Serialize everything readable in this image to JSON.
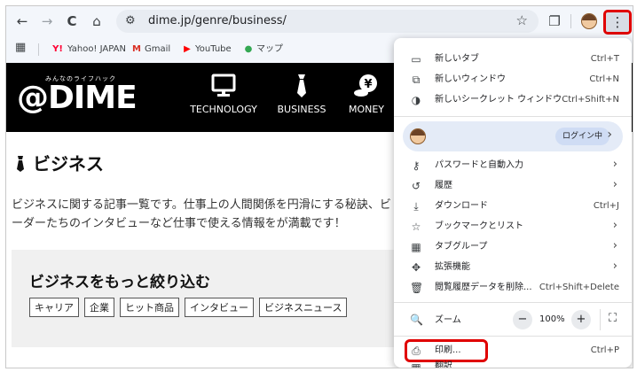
{
  "toolbar": {
    "back_icon": "←",
    "forward_icon": "→",
    "reload_icon": "C",
    "home_icon": "⌂",
    "site_info_icon": "⚙",
    "url": "dime.jp/genre/business/",
    "bookmark_star_icon": "☆",
    "extensions_icon": "❐",
    "menu_icon": "⋮"
  },
  "bookmarks": {
    "apps_icon": "▦",
    "items": [
      {
        "label": "Yahoo! JAPAN",
        "icon": "Y!",
        "color": "#ff0033"
      },
      {
        "label": "Gmail",
        "icon": "M",
        "color": "#d93025"
      },
      {
        "label": "YouTube",
        "icon": "▶",
        "color": "#ff0000"
      },
      {
        "label": "マップ",
        "icon": "●",
        "color": "#34a853"
      }
    ]
  },
  "site": {
    "logo_tagline": "みんなのライフハック",
    "logo": "@DIME",
    "nav": [
      {
        "label": "TECHNOLOGY",
        "icon": "monitor-icon"
      },
      {
        "label": "BUSINESS",
        "icon": "necktie-icon"
      },
      {
        "label": "MONEY",
        "icon": "yen-coins-icon"
      }
    ],
    "page_title_icon": "👔",
    "page_title": "ビジネス",
    "intro_line1": "ビジネスに関する記事一覧です。仕事上の人間関係を円滑にする秘訣、ビ",
    "intro_line2": "ーダーたちのインタビューなど仕事で使える情報をが満載です！",
    "narrow_title": "ビジネスをもっと絞り込む",
    "tags": [
      "キャリア",
      "企業",
      "ヒット商品",
      "インタビュー",
      "ビジネスニュース"
    ]
  },
  "menu": {
    "group1": [
      {
        "icon": "▭",
        "label": "新しいタブ",
        "shortcut": "Ctrl+T"
      },
      {
        "icon": "⧉",
        "label": "新しいウィンドウ",
        "shortcut": "Ctrl+N"
      },
      {
        "icon": "◑",
        "label": "新しいシークレット ウィンドウ",
        "shortcut": "Ctrl+Shift+N"
      }
    ],
    "profile_status": "ログイン中",
    "profile_arrow": "›",
    "group2": [
      {
        "icon": "⚷",
        "label": "パスワードと自動入力",
        "shortcut": "",
        "arrow": "›"
      },
      {
        "icon": "↺",
        "label": "履歴",
        "shortcut": "",
        "arrow": "›"
      },
      {
        "icon": "⤓",
        "label": "ダウンロード",
        "shortcut": "Ctrl+J",
        "arrow": ""
      },
      {
        "icon": "☆",
        "label": "ブックマークとリスト",
        "shortcut": "",
        "arrow": "›"
      },
      {
        "icon": "▦",
        "label": "タブグループ",
        "shortcut": "",
        "arrow": "›"
      },
      {
        "icon": "✥",
        "label": "拡張機能",
        "shortcut": "",
        "arrow": "›"
      },
      {
        "icon": "🗑",
        "label": "閲覧履歴データを削除...",
        "shortcut": "Ctrl+Shift+Delete",
        "arrow": ""
      }
    ],
    "zoom": {
      "icon": "🔍",
      "label": "ズーム",
      "minus": "−",
      "value": "100%",
      "plus": "+",
      "fullscreen": "⛶"
    },
    "print": {
      "icon": "⎙",
      "label": "印刷...",
      "shortcut": "Ctrl+P"
    },
    "partial_next": {
      "icon": "▦",
      "label": "翻訳"
    }
  },
  "highlight_color": "#e00000"
}
